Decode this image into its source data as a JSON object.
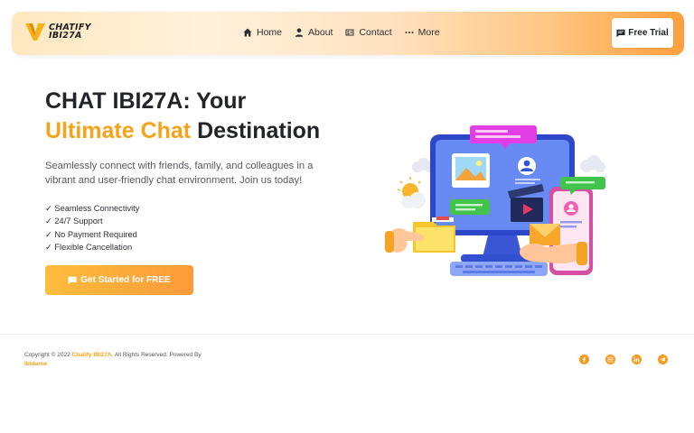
{
  "brand": {
    "line1": "CHATIFY",
    "line2": "IBI27A",
    "accent": "#f6a21b"
  },
  "nav": {
    "items": [
      {
        "label": "Home",
        "icon": "home-icon"
      },
      {
        "label": "About",
        "icon": "user-icon"
      },
      {
        "label": "Contact",
        "icon": "contact-card-icon"
      },
      {
        "label": "More",
        "icon": "ellipsis-icon"
      }
    ],
    "trial_label": "Free Trial",
    "trial_icon": "chat-icon"
  },
  "hero": {
    "title_line1": "CHAT IBI27A: Your",
    "title_accent": "Ultimate Chat",
    "title_rest": " Destination",
    "description": "Seamlessly connect with friends, family, and colleagues in a vibrant and user-friendly chat environment. Join us today!",
    "features": [
      "✓ Seamless Connectivity",
      "✓ 24/7 Support",
      "✓ No Payment Required",
      "✓ Flexible Cancellation"
    ],
    "cta_label": "Get Started for FREE",
    "cta_icon": "chat-icon"
  },
  "footer": {
    "copyright_prefix": "Copyright © 2022 ",
    "copyright_brand": "Chatify IBI27A",
    "copyright_suffix": ". All Rights Reserved. Powered By ",
    "powered_by": "Ibidarne",
    "socials": [
      "facebook-icon",
      "instagram-icon",
      "linkedin-icon",
      "telegram-icon"
    ],
    "social_color": "#f79a1d"
  }
}
